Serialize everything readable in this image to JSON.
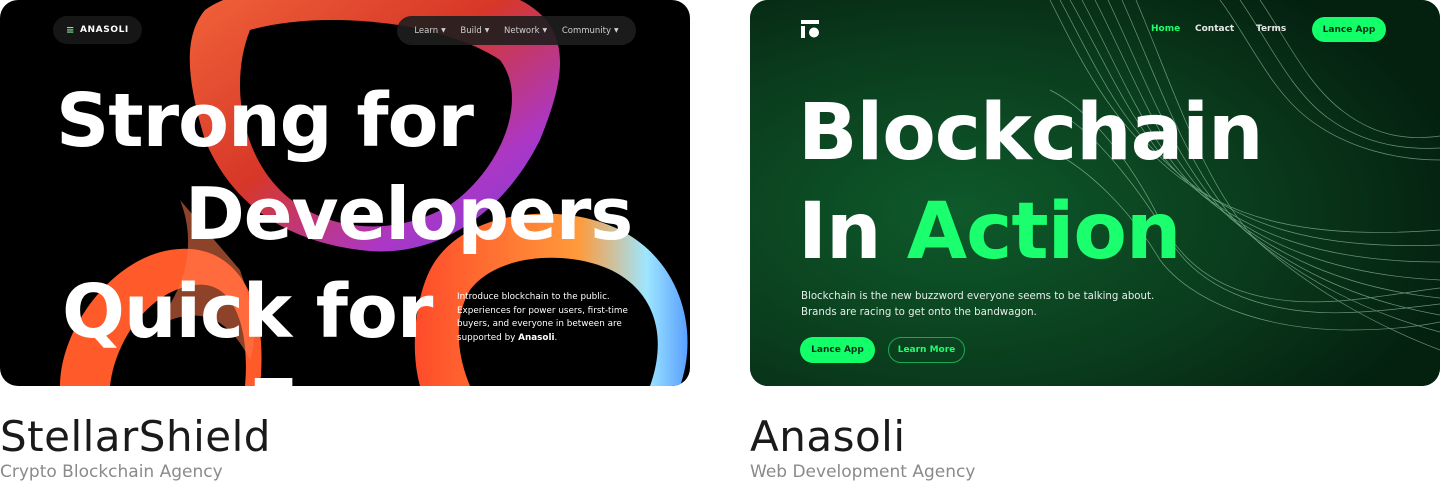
{
  "cards": [
    {
      "logo_text": "ANASOLI",
      "nav": [
        "Learn",
        "Build",
        "Network",
        "Community"
      ],
      "hero_lines": [
        "Strong for",
        "Developers",
        "Quick for",
        "E"
      ],
      "intro_text": "Introduce blockchain to the public. Experiences for power users, first-time buyers, and everyone in between are supported by",
      "intro_bold": "Anasoli",
      "intro_end": ".",
      "caption_title": "StellarShield",
      "caption_subtitle": "Crypto Blockchain Agency"
    },
    {
      "nav": [
        "Home",
        "Contact",
        "Terms"
      ],
      "nav_button": "Lance App",
      "hero_line1": "Blockchain",
      "hero_line2_prefix": "In ",
      "hero_line2_accent": "Action",
      "description": "Blockchain is the new buzzword everyone seems to be talking about. Brands are racing to get onto the bandwagon.",
      "primary_button": "Lance App",
      "secondary_button": "Learn More",
      "caption_title": "Anasoli",
      "caption_subtitle": "Web Development Agency"
    }
  ],
  "colors": {
    "accent_green": "#1bff6e",
    "dark_green_bg": "#0b3a1c",
    "left_bg": "#000000"
  }
}
